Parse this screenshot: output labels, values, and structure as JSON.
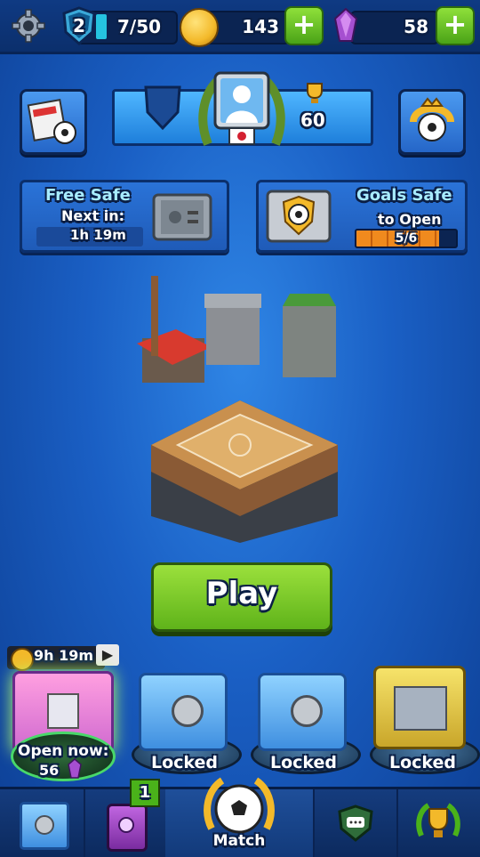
{
  "topbar": {
    "level": "2",
    "xp": "7/50",
    "coins": "143",
    "gems": "58"
  },
  "profile": {
    "trophies": "60"
  },
  "free_safe": {
    "title": "Free Safe",
    "next_label": "Next in:",
    "time": "1h 19m"
  },
  "goals_safe": {
    "title": "Goals Safe",
    "subtitle": "to Open",
    "progress_text": "5/6",
    "progress": 0.83
  },
  "play": {
    "label": "Play"
  },
  "chest_slots": [
    {
      "timer": "9h 19m",
      "open_label": "Open now:",
      "cost": "56"
    },
    {
      "status": "Locked"
    },
    {
      "status": "Locked"
    },
    {
      "status": "Locked"
    }
  ],
  "nav": {
    "badge": "1",
    "match_label": "Match"
  },
  "colors": {
    "accent_green": "#76c922",
    "background_blue": "#1a5fc4",
    "gem_purple": "#a64fd0",
    "coin_gold": "#f3b92a"
  },
  "icons": {
    "settings": "gear-icon",
    "level": "shield-icon",
    "coin": "coin-icon",
    "gem": "gem-icon",
    "news": "newspaper-icon",
    "trophy": "trophy-icon",
    "cup": "ball-crown-icon",
    "chat": "chat-icon",
    "safe": "safe-icon",
    "cards": "cards-icon",
    "match": "soccer-ball-icon"
  }
}
